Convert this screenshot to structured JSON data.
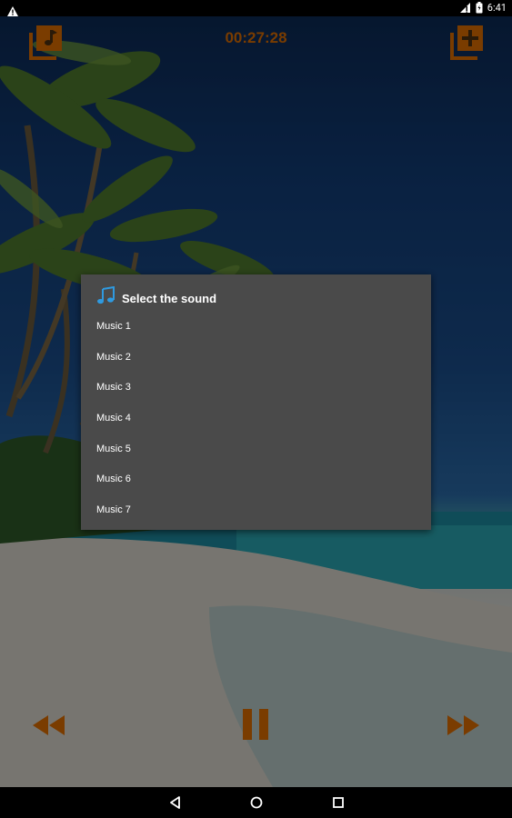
{
  "status_bar": {
    "time": "6:41",
    "icons": [
      "warning-icon",
      "signal-off-icon",
      "battery-icon"
    ]
  },
  "toolbar": {
    "timer": "00:27:28",
    "left_icon": "music-library-icon",
    "right_icon": "add-sound-icon"
  },
  "dialog": {
    "title": "Select the sound",
    "title_icon": "music-note-icon",
    "items": [
      "Music 1",
      "Music 2",
      "Music 3",
      "Music 4",
      "Music 5",
      "Music 6",
      "Music 7"
    ]
  },
  "playback": {
    "buttons": [
      "rewind-icon",
      "pause-icon",
      "fast-forward-icon"
    ]
  },
  "nav_bar": {
    "buttons": [
      "back-icon",
      "home-icon",
      "recents-icon"
    ]
  },
  "colors": {
    "accent": "#7a3c00",
    "dialog_background": "#4a4a4a",
    "dialog_text": "#ffffff",
    "title_icon": "#2f9ae0"
  }
}
